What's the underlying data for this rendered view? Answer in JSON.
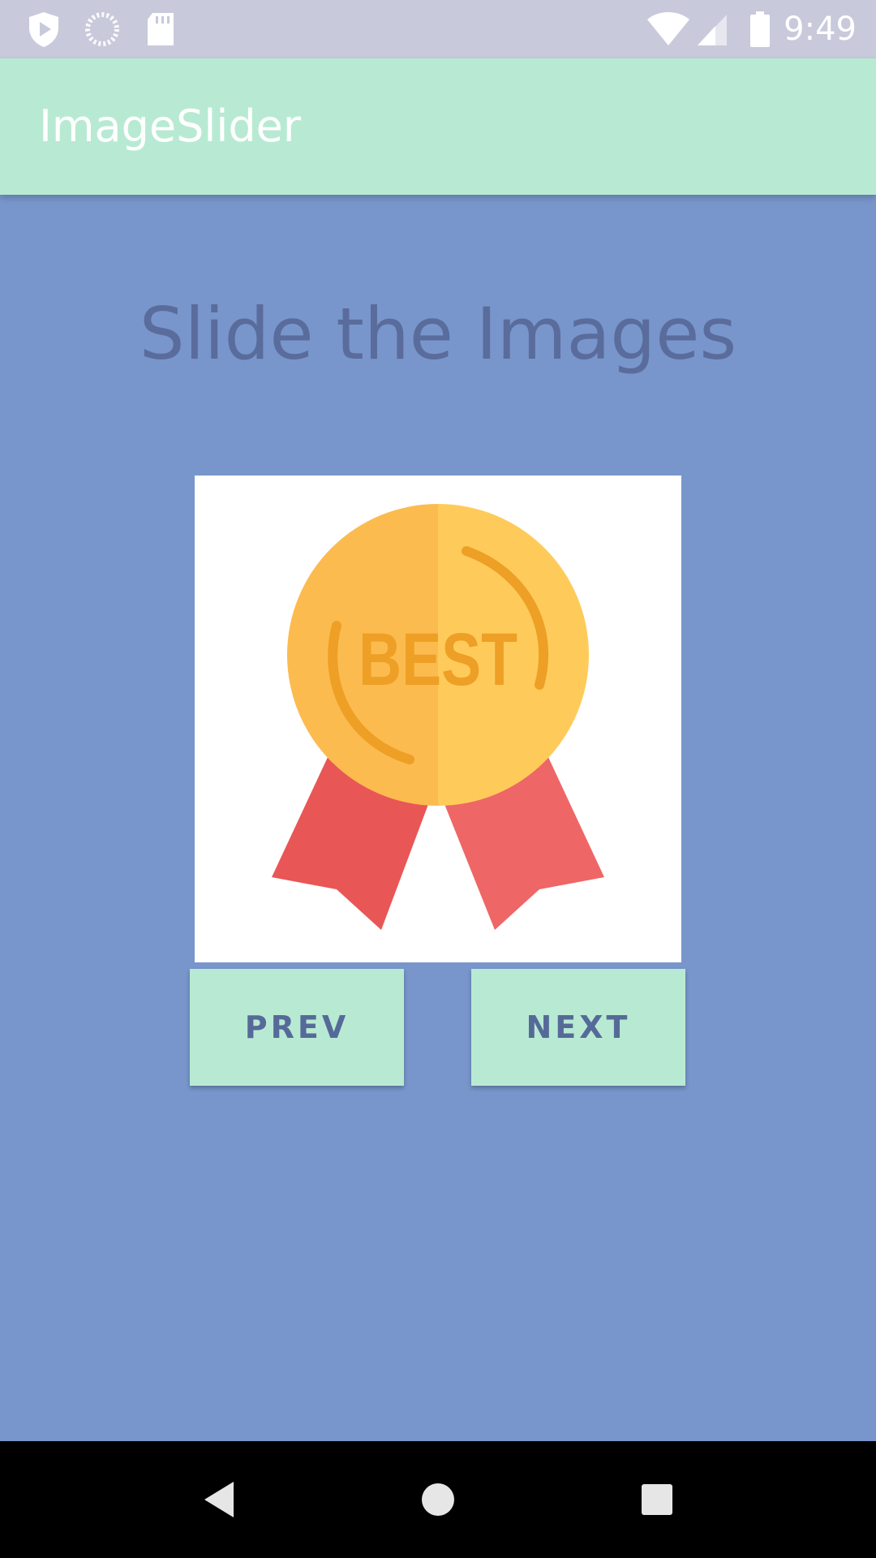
{
  "status_bar": {
    "time": "9:49",
    "icons": [
      "play-shield-icon",
      "loading-icon",
      "sd-card-icon",
      "wifi-icon",
      "cell-signal-icon",
      "battery-icon"
    ]
  },
  "app_bar": {
    "title": "ImageSlider"
  },
  "main": {
    "headline": "Slide the Images",
    "image": {
      "icon": "best-medal-icon",
      "badge_text": "BEST"
    },
    "buttons": {
      "prev_label": "PREV",
      "next_label": "NEXT"
    }
  },
  "nav_bar": {
    "icons": [
      "back-icon",
      "home-icon",
      "recents-icon"
    ]
  },
  "colors": {
    "status_bar": "#c8cadb",
    "app_bar": "#b8ead3",
    "background": "#7896cb",
    "headline": "#5a6c9c",
    "button": "#b8ead3",
    "button_text": "#566a99",
    "medal_left": "#fcbb4f",
    "medal_right": "#fecb5b",
    "ribbon": "#e95656"
  }
}
